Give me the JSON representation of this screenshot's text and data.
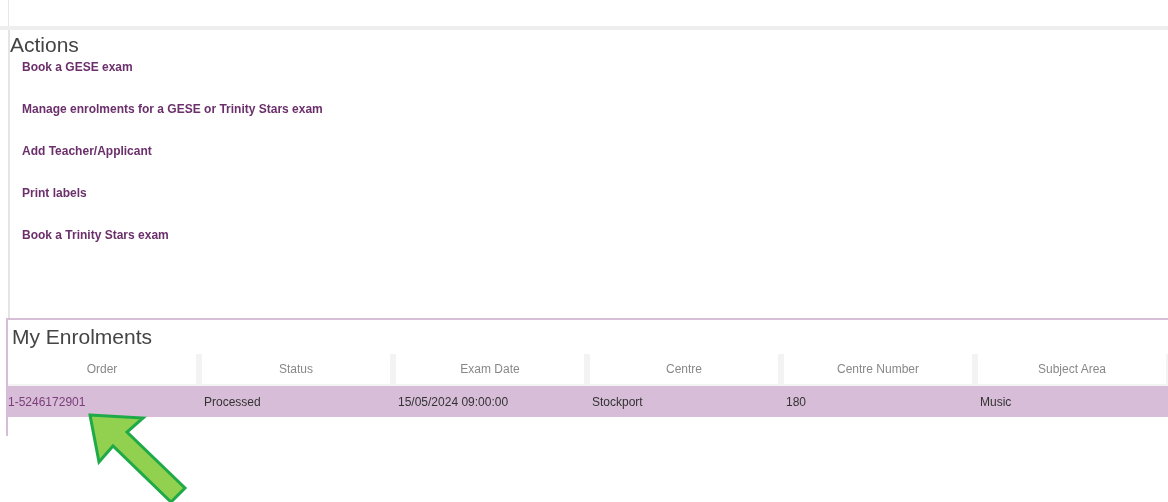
{
  "actions": {
    "title": "Actions",
    "links": [
      "Book a GESE exam",
      "Manage enrolments for a GESE or Trinity Stars exam",
      "Add Teacher/Applicant",
      "Print labels",
      "Book a Trinity Stars exam"
    ]
  },
  "enrolments": {
    "title": "My Enrolments",
    "columns": [
      "Order",
      "Status",
      "Exam Date",
      "Centre",
      "Centre Number",
      "Subject Area"
    ],
    "rows": [
      {
        "selected": true,
        "cells": [
          "1-5246172901",
          "Processed",
          "15/05/2024 09:00:00",
          "Stockport",
          "180",
          "Music"
        ]
      }
    ]
  }
}
